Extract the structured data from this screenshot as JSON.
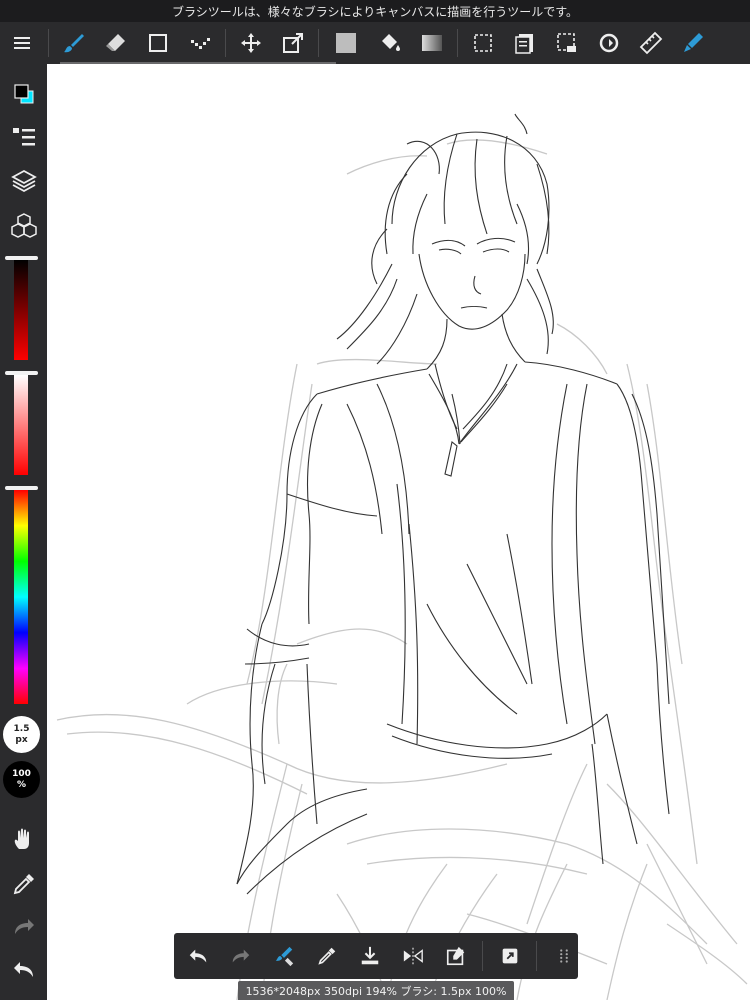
{
  "hint": "ブラシツールは、様々なブラシによりキャンバスに描画を行うツールです。",
  "toolbar": {
    "items": [
      "menu-icon",
      "brush-icon",
      "eraser-icon",
      "rectangle-select-icon",
      "dot-icon",
      "move-icon",
      "transform-icon",
      "fill-color-icon",
      "bucket-icon",
      "gradient-icon",
      "select-icon",
      "layer-panel-icon",
      "select-all-icon",
      "rotate-icon",
      "ruler-icon",
      "pen-icon"
    ],
    "active_color": "#2d9bd6"
  },
  "sidebar": {
    "foreground_color": "#000000",
    "background_color": "#00e5ff",
    "brush_size": "1.5",
    "brush_size_unit": "px",
    "opacity": "100",
    "opacity_unit": "%"
  },
  "bottom_toolbar": {
    "items": [
      "undo-icon",
      "redo-icon",
      "brush-eraser-icon",
      "eyedropper-icon",
      "save-icon",
      "flip-icon",
      "clear-icon",
      "fullscreen-icon",
      "grid-icon"
    ]
  },
  "status": "1536*2048px 350dpi 194% ブラシ: 1.5px 100%"
}
